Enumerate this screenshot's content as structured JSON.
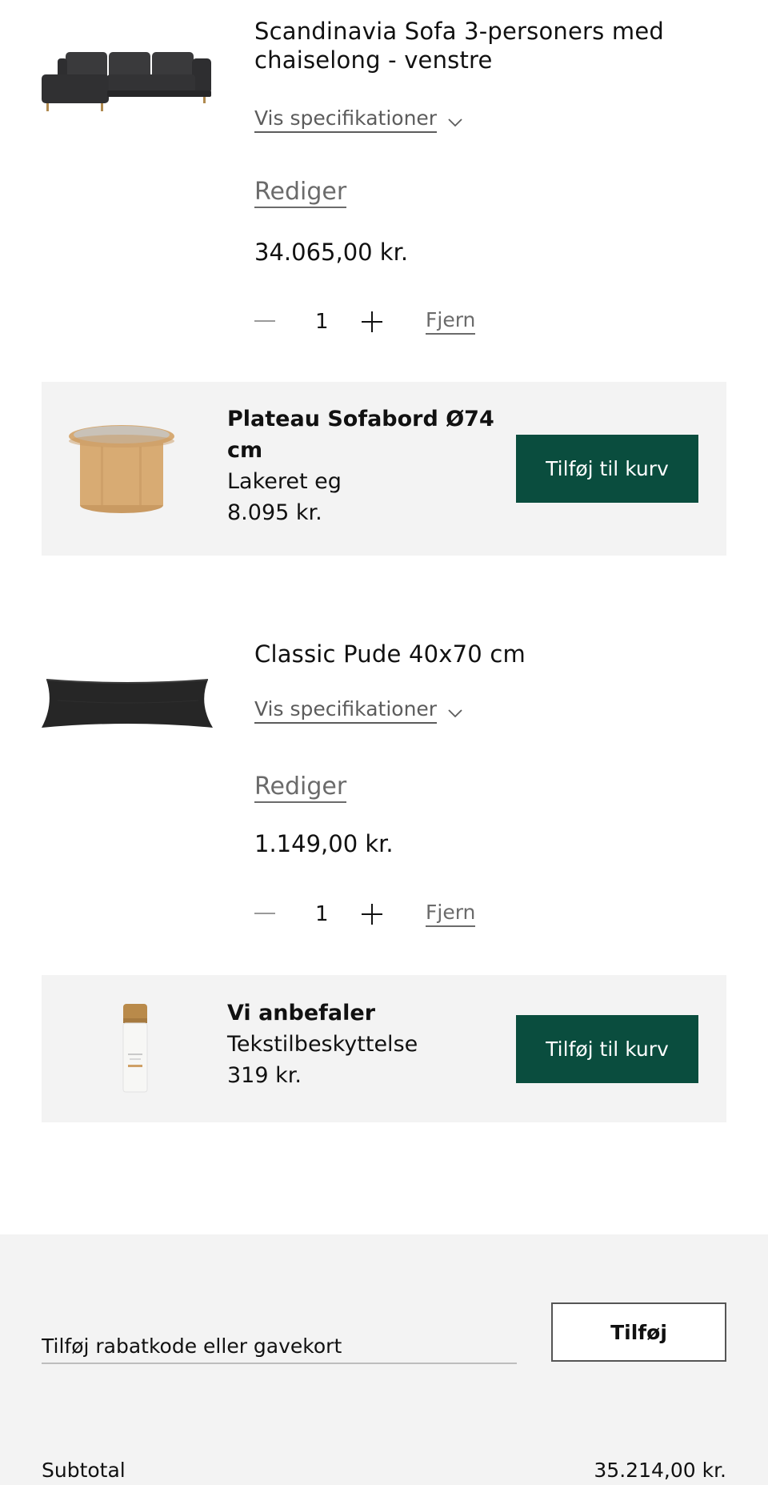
{
  "cart_items": [
    {
      "title": "Scandinavia Sofa 3-personers med chaiselong - venstre",
      "spec_label": "Vis specifikationer",
      "edit_label": "Rediger",
      "price": "34.065,00 kr.",
      "quantity": "1",
      "remove_label": "Fjern",
      "image_icon": "sofa-image"
    },
    {
      "title": "Classic Pude 40x70 cm",
      "spec_label": "Vis specifikationer",
      "edit_label": "Rediger",
      "price": "1.149,00 kr.",
      "quantity": "1",
      "remove_label": "Fjern",
      "image_icon": "cushion-image"
    }
  ],
  "recommendations": [
    {
      "name": "Plateau Sofabord Ø74 cm",
      "variant": "Lakeret eg",
      "price": "8.095 kr.",
      "button_label": "Tilføj til kurv",
      "image_icon": "coffee-table-image"
    },
    {
      "name": "Vi anbefaler",
      "variant": "Tekstilbeskyttelse",
      "price": "319 kr.",
      "button_label": "Tilføj til kurv",
      "image_icon": "spray-bottle-image"
    }
  ],
  "summary": {
    "discount_placeholder": "Tilføj rabatkode eller gavekort",
    "apply_label": "Tilføj",
    "subtotal_label": "Subtotal",
    "subtotal_value": "35.214,00 kr."
  },
  "colors": {
    "primary_button": "#0a4d3e",
    "panel_background": "#f3f3f3",
    "muted_text": "#6b6b6b"
  }
}
